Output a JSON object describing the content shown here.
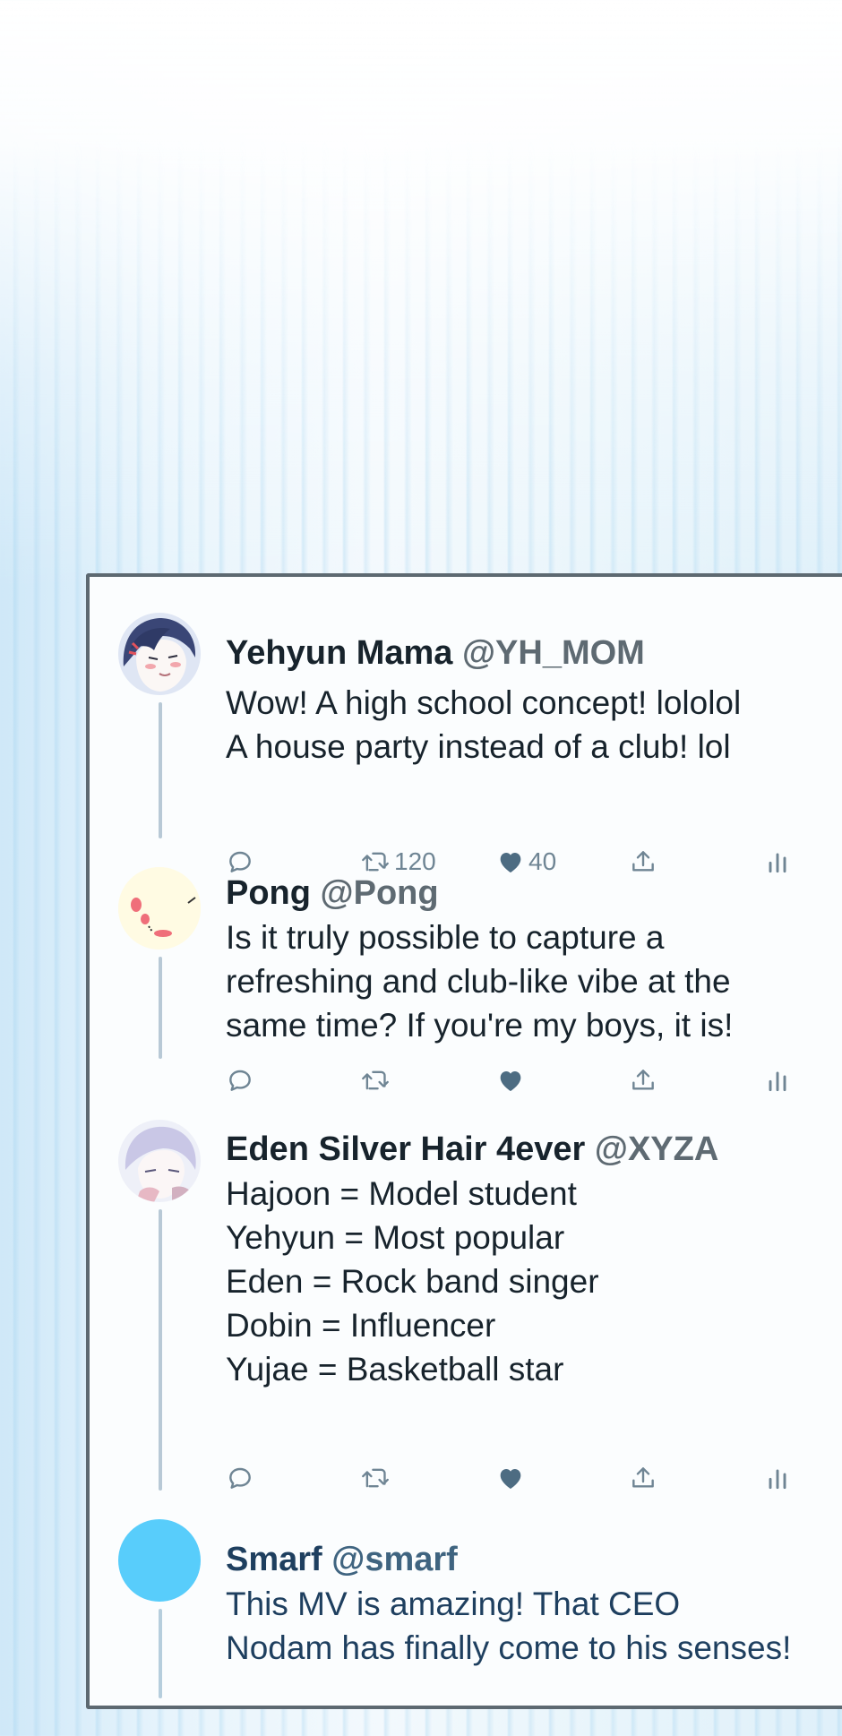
{
  "tweets": [
    {
      "name": "Yehyun Mama",
      "handle": "@YH_MOM",
      "lines": [
        "Wow! A high school concept! lololol",
        "A house party instead of a club! lol"
      ],
      "retweets": "120",
      "likes": "40"
    },
    {
      "name": "Pong",
      "handle": "@Pong",
      "lines": [
        "Is it truly possible to capture a",
        "refreshing and club-like vibe at the",
        "same time? If you're my boys, it is!"
      ],
      "retweets": "",
      "likes": ""
    },
    {
      "name": "Eden Silver Hair 4ever",
      "handle": "@XYZA",
      "lines": [
        "Hajoon = Model student",
        "Yehyun = Most popular",
        "Eden = Rock band singer",
        "Dobin = Influencer",
        "Yujae = Basketball star"
      ],
      "retweets": "",
      "likes": ""
    },
    {
      "name": "Smarf",
      "handle": "@smarf",
      "lines": [
        "This MV is amazing! That CEO",
        "Nodam has finally come to his senses!"
      ]
    }
  ],
  "icons": {
    "reply": "reply-icon",
    "retweet": "retweet-icon",
    "like": "heart-icon",
    "share": "share-icon",
    "views": "views-icon"
  },
  "colors": {
    "card_border": "#5d6971",
    "icon": "#6f8594",
    "smarf_avatar": "#58cdfb",
    "pong_avatar_bg": "#fffbe3"
  }
}
